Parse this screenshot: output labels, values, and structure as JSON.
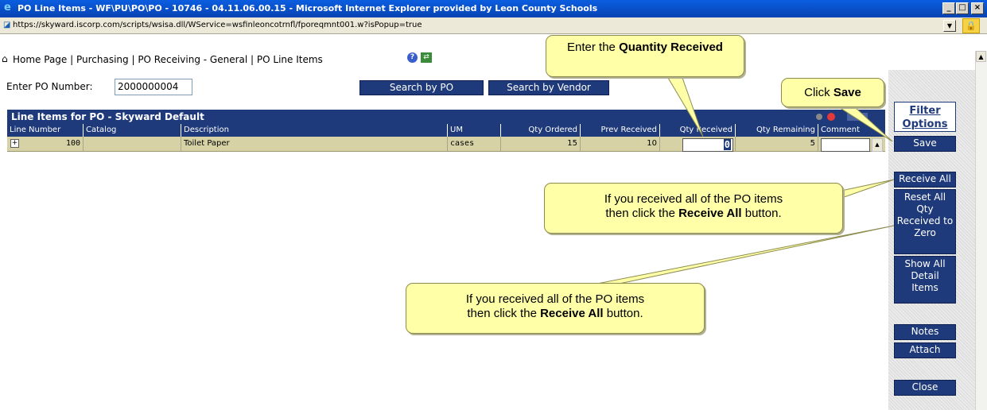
{
  "window": {
    "title": "PO Line Items - WF\\PU\\PO\\PO - 10746 - 04.11.06.00.15 - Microsoft Internet Explorer provided by Leon County Schools",
    "btn_min": "_",
    "btn_max": "□",
    "btn_close": "×"
  },
  "address": {
    "url": "https://skyward.iscorp.com/scripts/wsisa.dll/WService=wsfinleoncotrnfl/fporeqmnt001.w?isPopup=true"
  },
  "breadcrumb": {
    "text": "Home Page | Purchasing | PO Receiving - General | PO Line Items"
  },
  "search": {
    "label": "Enter PO Number:",
    "po_number": "2000000004",
    "by_po": "Search by PO",
    "by_vendor": "Search by Vendor"
  },
  "grid": {
    "title": "Line Items for PO - Skyward Default",
    "columns": [
      "Line Number",
      "Catalog",
      "Description",
      "UM",
      "Qty Ordered",
      "Prev Received",
      "Qty Received",
      "Qty Remaining",
      "Comment"
    ],
    "rows": [
      {
        "line_number": "100",
        "catalog": "",
        "description": "Toilet Paper",
        "um": "cases",
        "qty_ordered": "15",
        "prev_received": "10",
        "qty_received": "0",
        "qty_remaining": "5",
        "comment": ""
      }
    ]
  },
  "sidebar": {
    "filter_options": "Filter Options",
    "save": "Save",
    "receive_all": "Receive All",
    "reset_all": "Reset All Qty Received to Zero",
    "show_all": "Show All Detail Items",
    "notes": "Notes",
    "attach": "Attach",
    "close": "Close"
  },
  "callouts": {
    "qty_prefix": "Enter the ",
    "qty_bold": "Quantity Received",
    "save_prefix": "Click ",
    "save_bold": "Save",
    "receive_line1": "If you received all of the PO items",
    "receive_line2_prefix": "then click the ",
    "receive_bold": "Receive All",
    "receive_line2_suffix": " button.",
    "reset_line1": "If you received all of the PO items",
    "reset_line2_prefix": "then click the ",
    "reset_bold": "Receive All",
    "reset_line2_suffix": " button."
  },
  "colors": {
    "titlebar": "#0a5ee0",
    "grid_header": "#1f3a7a",
    "row_bg": "#d6d2a6",
    "callout_bg": "#ffffa8"
  }
}
